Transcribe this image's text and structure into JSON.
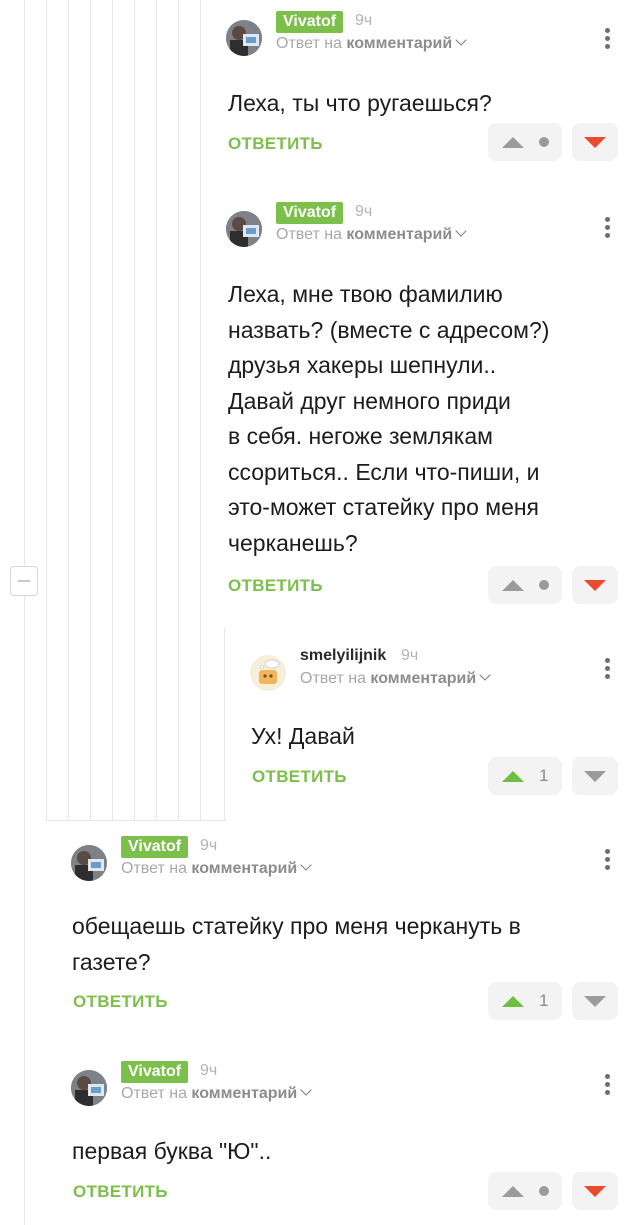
{
  "labels": {
    "reply_prefix": "Ответ на",
    "reply_target": "комментарий",
    "reply_button": "ОТВЕТИТЬ"
  },
  "colors": {
    "accent_green": "#7cbf4b",
    "upvote_active": "#6cbf3f",
    "downvote_active": "#ea4b2c"
  },
  "comments": [
    {
      "username": "Vivatof",
      "username_style": "badge",
      "time": "9ч",
      "text": "Леха, ты что ругаешься?",
      "vote": {
        "up_active": false,
        "down_active": true,
        "rating": null,
        "rating_icon": "dot-icon"
      }
    },
    {
      "username": "Vivatof",
      "username_style": "badge",
      "time": "9ч",
      "text_lines": [
        "Леха, мне твою фамилию",
        "назвать? (вместе с адресом?)",
        "друзья хакеры шепнули..",
        "Давай друг немного приди",
        "в себя. негоже землякам",
        "ссориться.. Если что-пиши, и",
        "это-может статейку про меня",
        "черканешь?"
      ],
      "vote": {
        "up_active": false,
        "down_active": true,
        "rating": null,
        "rating_icon": "dot-icon"
      }
    },
    {
      "username": "smelyilijnik",
      "username_style": "plain",
      "time": "9ч",
      "text": "Ух! Давай",
      "vote": {
        "up_active": true,
        "down_active": false,
        "rating": "1"
      }
    },
    {
      "username": "Vivatof",
      "username_style": "badge",
      "time": "9ч",
      "text_lines": [
        "обещаешь статейку про меня черкануть в",
        "газете?"
      ],
      "vote": {
        "up_active": true,
        "down_active": false,
        "rating": "1"
      }
    },
    {
      "username": "Vivatof",
      "username_style": "badge",
      "time": "9ч",
      "text": "первая буква \"Ю\"..",
      "vote": {
        "up_active": false,
        "down_active": true,
        "rating": null,
        "rating_icon": "dot-icon"
      }
    }
  ]
}
